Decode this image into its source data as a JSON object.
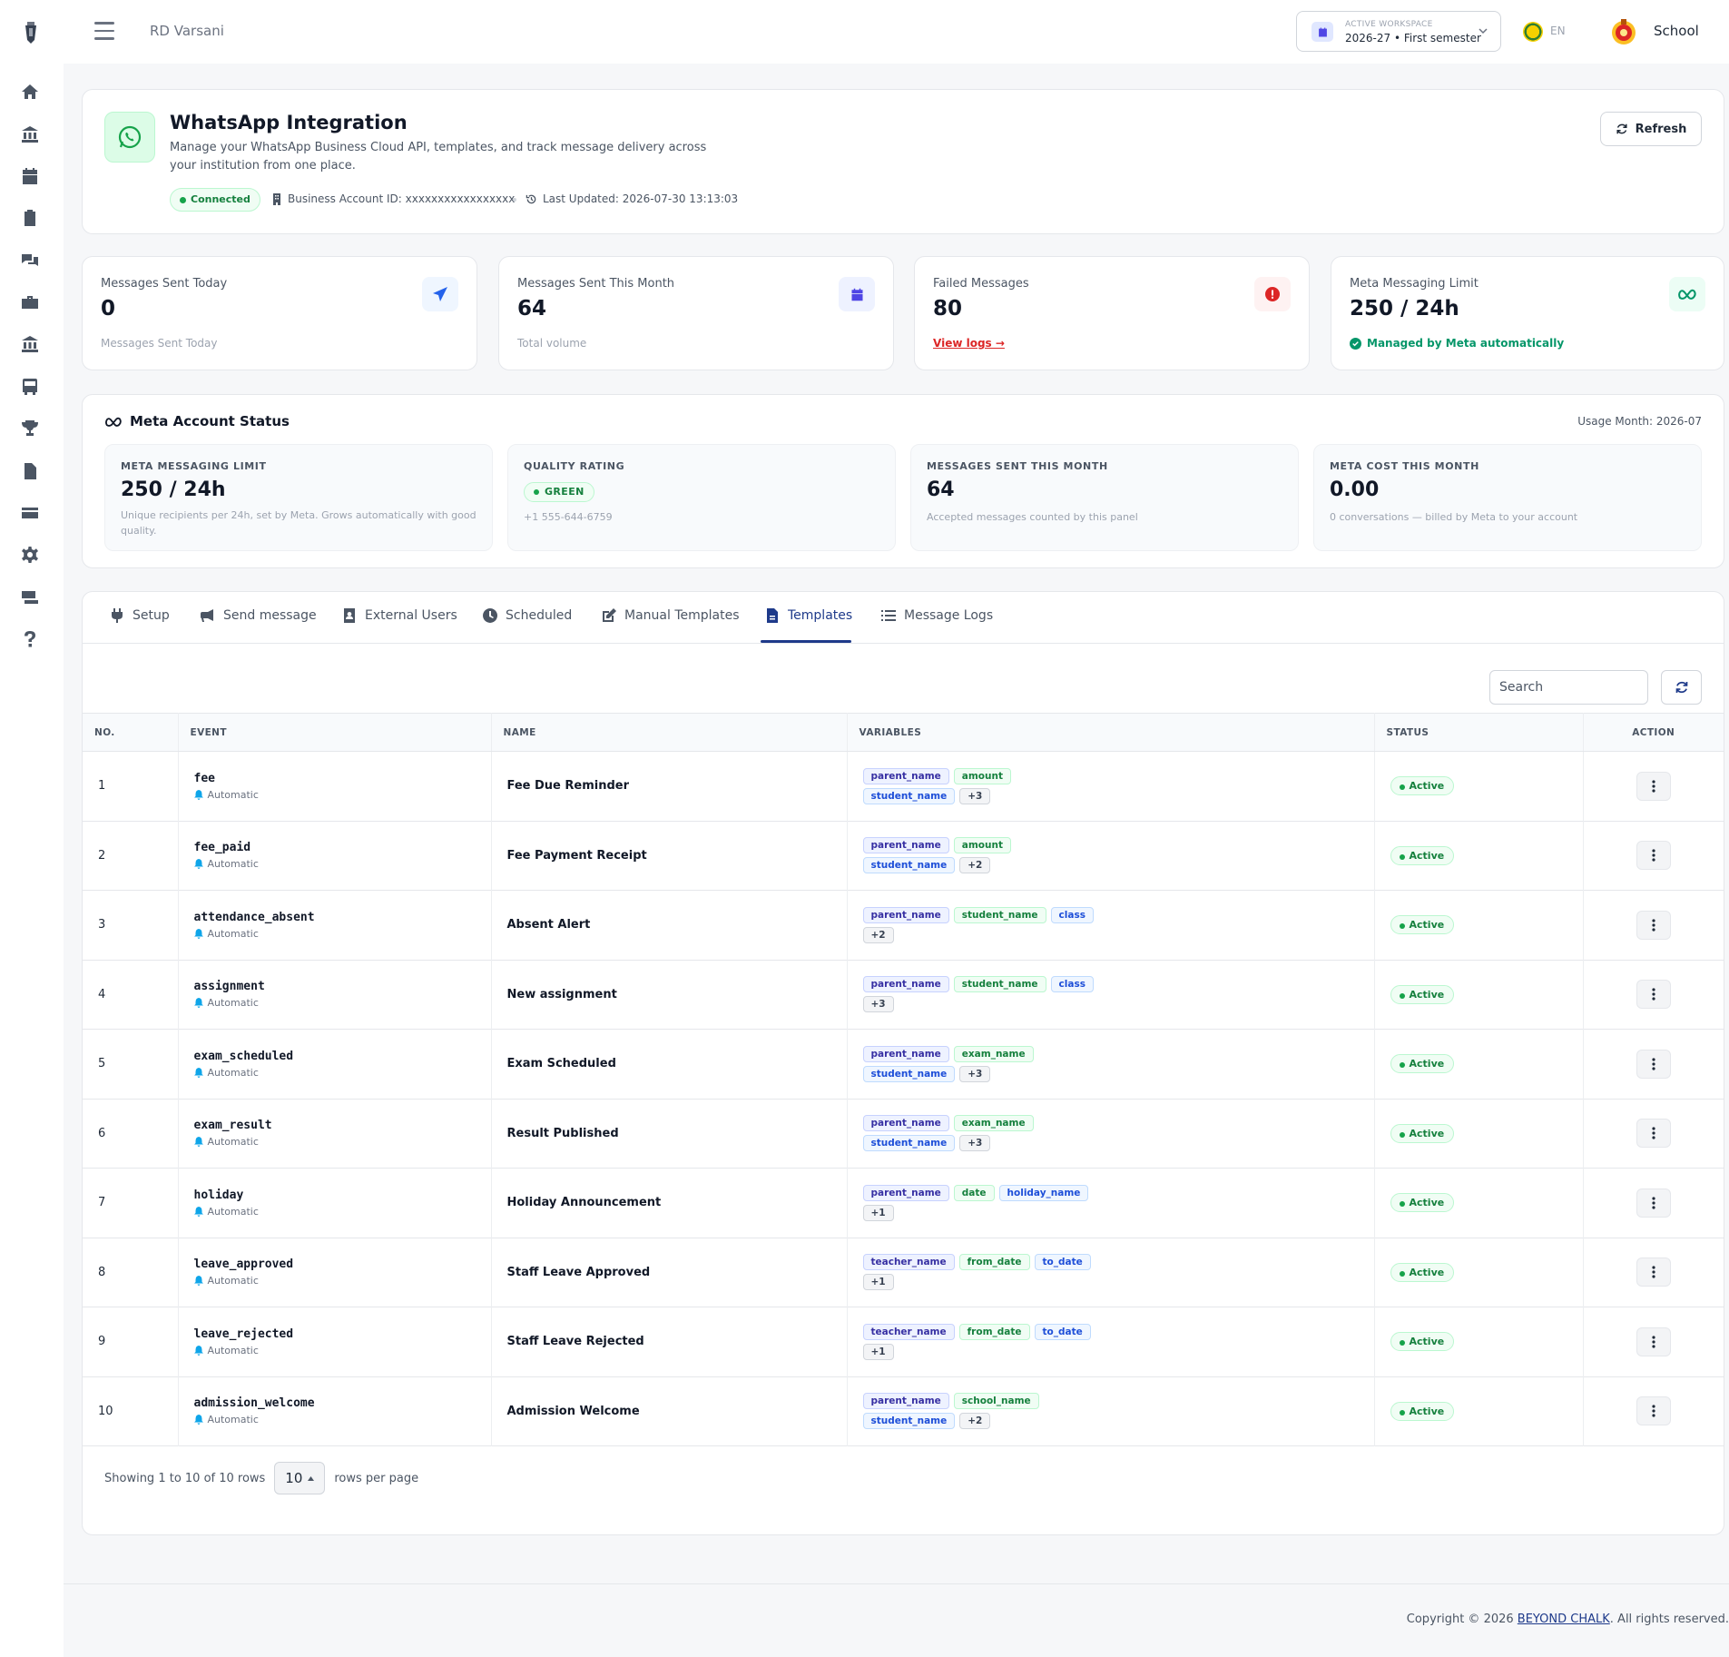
{
  "topbar": {
    "org_name": "RD Varsani",
    "workspace_label": "ACTIVE WORKSPACE",
    "workspace_value": "2026-27 • First semester",
    "lang": "EN",
    "user": "School"
  },
  "sidebar": {
    "items": [
      "home-icon",
      "bank-icon",
      "calendar-icon",
      "clipboard-icon",
      "chat-icon",
      "briefcase-icon",
      "institution-icon",
      "bus-icon",
      "trophy-icon",
      "document-icon",
      "card-icon",
      "gear-icon",
      "money-icon",
      "help-icon"
    ]
  },
  "header": {
    "title": "WhatsApp Integration",
    "description": "Manage your WhatsApp Business Cloud API, templates, and track message delivery across your institution from one place.",
    "status": "Connected",
    "business_account": "Business Account ID: xxxxxxxxxxxxxxxxx",
    "last_updated": "Last Updated: 2026-07-30 13:13:03",
    "refresh_label": "Refresh"
  },
  "stats": [
    {
      "label": "Messages Sent Today",
      "value": "0",
      "sub": "Messages Sent Today",
      "icon": "send-icon"
    },
    {
      "label": "Messages Sent This Month",
      "value": "64",
      "sub": "Total volume",
      "icon": "calendar-icon"
    },
    {
      "label": "Failed Messages",
      "value": "80",
      "sub": "View logs →",
      "icon": "alert-icon"
    },
    {
      "label": "Meta Messaging Limit",
      "value": "250 / 24h",
      "sub": "Managed by Meta automatically",
      "icon": "meta-icon"
    }
  ],
  "meta_status": {
    "title": "Meta Account Status",
    "usage_month": "Usage Month: 2026-07",
    "boxes": [
      {
        "label": "META MESSAGING LIMIT",
        "value": "250 / 24h",
        "desc": "Unique recipients per 24h, set by Meta. Grows automatically with good quality."
      },
      {
        "label": "QUALITY RATING",
        "value": "GREEN",
        "desc": "+1 555-644-6759"
      },
      {
        "label": "MESSAGES SENT THIS MONTH",
        "value": "64",
        "desc": "Accepted messages counted by this panel"
      },
      {
        "label": "META COST THIS MONTH",
        "value": "0.00",
        "desc": "0 conversations — billed by Meta to your account"
      }
    ]
  },
  "tabs": [
    {
      "label": "Setup",
      "icon": "plug-icon"
    },
    {
      "label": "Send message",
      "icon": "megaphone-icon"
    },
    {
      "label": "External Users",
      "icon": "contact-icon"
    },
    {
      "label": "Scheduled",
      "icon": "clock-icon"
    },
    {
      "label": "Manual Templates",
      "icon": "edit-icon"
    },
    {
      "label": "Templates",
      "icon": "file-icon",
      "active": true
    },
    {
      "label": "Message Logs",
      "icon": "list-icon"
    }
  ],
  "search": {
    "placeholder": "Search"
  },
  "table": {
    "columns": [
      "NO.",
      "EVENT",
      "NAME",
      "VARIABLES",
      "STATUS",
      "ACTION"
    ],
    "rows": [
      {
        "no": "1",
        "event": "fee",
        "trigger": "Automatic",
        "name": "Fee Due Reminder",
        "vars": [
          [
            "parent_name",
            "i"
          ],
          [
            "amount",
            "g"
          ],
          [
            "student_name",
            "s"
          ],
          [
            "+3",
            "m"
          ]
        ],
        "status": "Active"
      },
      {
        "no": "2",
        "event": "fee_paid",
        "trigger": "Automatic",
        "name": "Fee Payment Receipt",
        "vars": [
          [
            "parent_name",
            "i"
          ],
          [
            "amount",
            "g"
          ],
          [
            "student_name",
            "s"
          ],
          [
            "+2",
            "m"
          ]
        ],
        "status": "Active"
      },
      {
        "no": "3",
        "event": "attendance_absent",
        "trigger": "Automatic",
        "name": "Absent Alert",
        "vars": [
          [
            "parent_name",
            "i"
          ],
          [
            "student_name",
            "g"
          ],
          [
            "class",
            "s"
          ],
          [
            "+2",
            "m"
          ]
        ],
        "status": "Active"
      },
      {
        "no": "4",
        "event": "assignment",
        "trigger": "Automatic",
        "name": "New assignment",
        "vars": [
          [
            "parent_name",
            "i"
          ],
          [
            "student_name",
            "g"
          ],
          [
            "class",
            "s"
          ],
          [
            "+3",
            "m"
          ]
        ],
        "status": "Active"
      },
      {
        "no": "5",
        "event": "exam_scheduled",
        "trigger": "Automatic",
        "name": "Exam Scheduled",
        "vars": [
          [
            "parent_name",
            "i"
          ],
          [
            "exam_name",
            "g"
          ],
          [
            "student_name",
            "s"
          ],
          [
            "+3",
            "m"
          ]
        ],
        "status": "Active"
      },
      {
        "no": "6",
        "event": "exam_result",
        "trigger": "Automatic",
        "name": "Result Published",
        "vars": [
          [
            "parent_name",
            "i"
          ],
          [
            "exam_name",
            "g"
          ],
          [
            "student_name",
            "s"
          ],
          [
            "+3",
            "m"
          ]
        ],
        "status": "Active"
      },
      {
        "no": "7",
        "event": "holiday",
        "trigger": "Automatic",
        "name": "Holiday Announcement",
        "vars": [
          [
            "parent_name",
            "i"
          ],
          [
            "date",
            "g"
          ],
          [
            "holiday_name",
            "s"
          ],
          [
            "+1",
            "m"
          ]
        ],
        "status": "Active"
      },
      {
        "no": "8",
        "event": "leave_approved",
        "trigger": "Automatic",
        "name": "Staff Leave Approved",
        "vars": [
          [
            "teacher_name",
            "i"
          ],
          [
            "from_date",
            "g"
          ],
          [
            "to_date",
            "s"
          ],
          [
            "+1",
            "m"
          ]
        ],
        "status": "Active"
      },
      {
        "no": "9",
        "event": "leave_rejected",
        "trigger": "Automatic",
        "name": "Staff Leave Rejected",
        "vars": [
          [
            "teacher_name",
            "i"
          ],
          [
            "from_date",
            "g"
          ],
          [
            "to_date",
            "s"
          ],
          [
            "+1",
            "m"
          ]
        ],
        "status": "Active"
      },
      {
        "no": "10",
        "event": "admission_welcome",
        "trigger": "Automatic",
        "name": "Admission Welcome",
        "vars": [
          [
            "parent_name",
            "i"
          ],
          [
            "school_name",
            "g"
          ],
          [
            "student_name",
            "s"
          ],
          [
            "+2",
            "m"
          ]
        ],
        "status": "Active"
      }
    ]
  },
  "pager": {
    "showing": "Showing 1 to 10 of 10 rows",
    "page_size": "10",
    "suffix": "rows per page"
  },
  "footer": {
    "prefix": "Copyright © 2026 ",
    "brand": "BEYOND CHALK",
    "suffix": ". All rights reserved."
  }
}
